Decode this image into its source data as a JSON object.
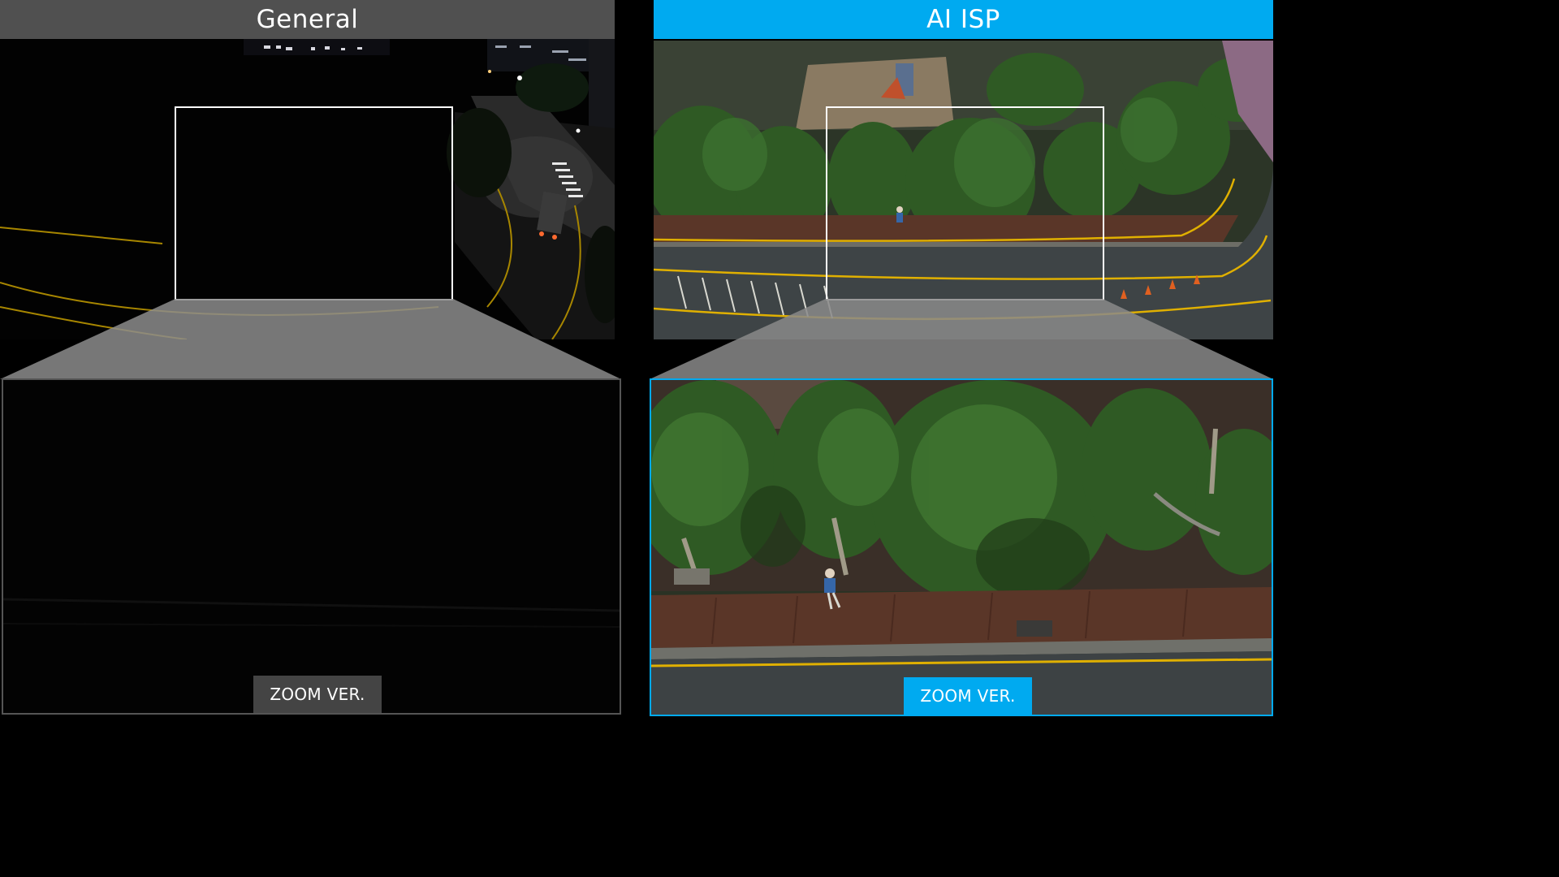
{
  "left": {
    "title": "General",
    "zoom_label": "ZOOM VER.",
    "title_bg": "#505050",
    "badge_bg": "#444444"
  },
  "right": {
    "title": "AI ISP",
    "zoom_label": "ZOOM VER.",
    "accent": "#00aaf0"
  },
  "scene": {
    "road_line_color": "#e0b000",
    "tree_color": "#2f5a24",
    "sidewalk_color": "#5a3628"
  }
}
